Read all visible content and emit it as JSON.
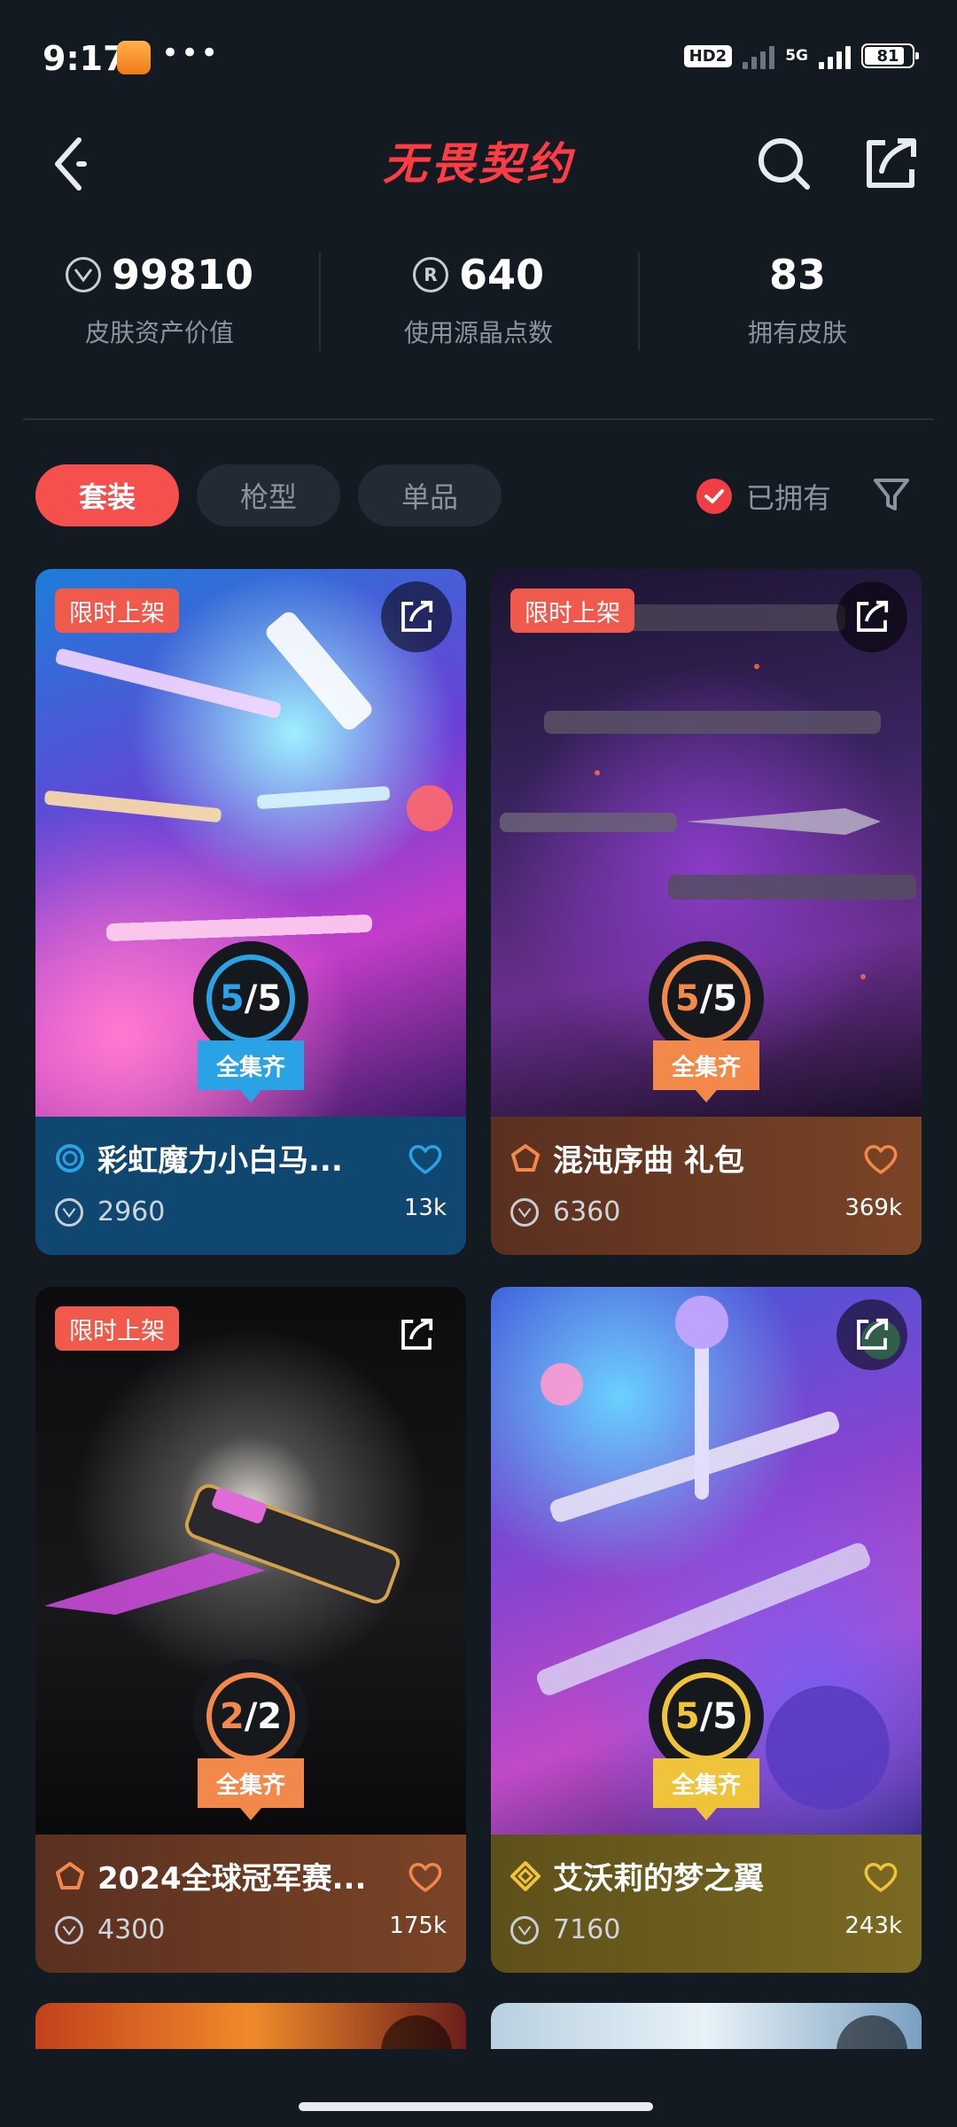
{
  "status_bar": {
    "time": "9:17",
    "dots": "•••",
    "hd_label": "HD2",
    "network": "5G",
    "battery": "81"
  },
  "header": {
    "title": "无畏契约",
    "icons": [
      "back-icon",
      "search-icon",
      "share-icon"
    ]
  },
  "stats": [
    {
      "value": "99810",
      "label": "皮肤资产价值",
      "icon": "v-coin-icon"
    },
    {
      "value": "640",
      "label": "使用源晶点数",
      "icon": "r-coin-icon",
      "icon_text": "R"
    },
    {
      "value": "83",
      "label": "拥有皮肤"
    }
  ],
  "tabs": [
    {
      "label": "套装",
      "active": true
    },
    {
      "label": "枪型",
      "active": false
    },
    {
      "label": "单品",
      "active": false
    }
  ],
  "owned_filter": {
    "label": "已拥有",
    "checked": true
  },
  "cards": [
    {
      "badge": "限时上架",
      "progress_num": "5",
      "progress_sep": "/",
      "progress_den": "5",
      "progress_label": "全集齐",
      "tier_color": "#2aa2e6",
      "footer_color": "#0f4770",
      "name": "彩虹魔力小白马...",
      "price": "2960",
      "likes": "13k",
      "tier_icon": "tier-swirl-icon"
    },
    {
      "badge": "限时上架",
      "progress_num": "5",
      "progress_sep": "/",
      "progress_den": "5",
      "progress_label": "全集齐",
      "tier_color": "#f2894a",
      "footer_color": "#6b3a22",
      "name": "混沌序曲 礼包",
      "price": "6360",
      "likes": "369k",
      "tier_icon": "tier-pentagon-icon"
    },
    {
      "badge": "限时上架",
      "progress_num": "2",
      "progress_sep": "/",
      "progress_den": "2",
      "progress_label": "全集齐",
      "tier_color": "#f2894a",
      "footer_color": "#6b3a22",
      "name": "2024全球冠军赛...",
      "price": "4300",
      "likes": "175k",
      "tier_icon": "tier-pentagon-icon"
    },
    {
      "badge": "",
      "progress_num": "5",
      "progress_sep": "/",
      "progress_den": "5",
      "progress_label": "全集齐",
      "tier_color": "#f0c43a",
      "footer_color": "#6e5c1e",
      "name": "艾沃莉的梦之翼",
      "price": "7160",
      "likes": "243k",
      "tier_icon": "tier-diamond-icon"
    }
  ]
}
